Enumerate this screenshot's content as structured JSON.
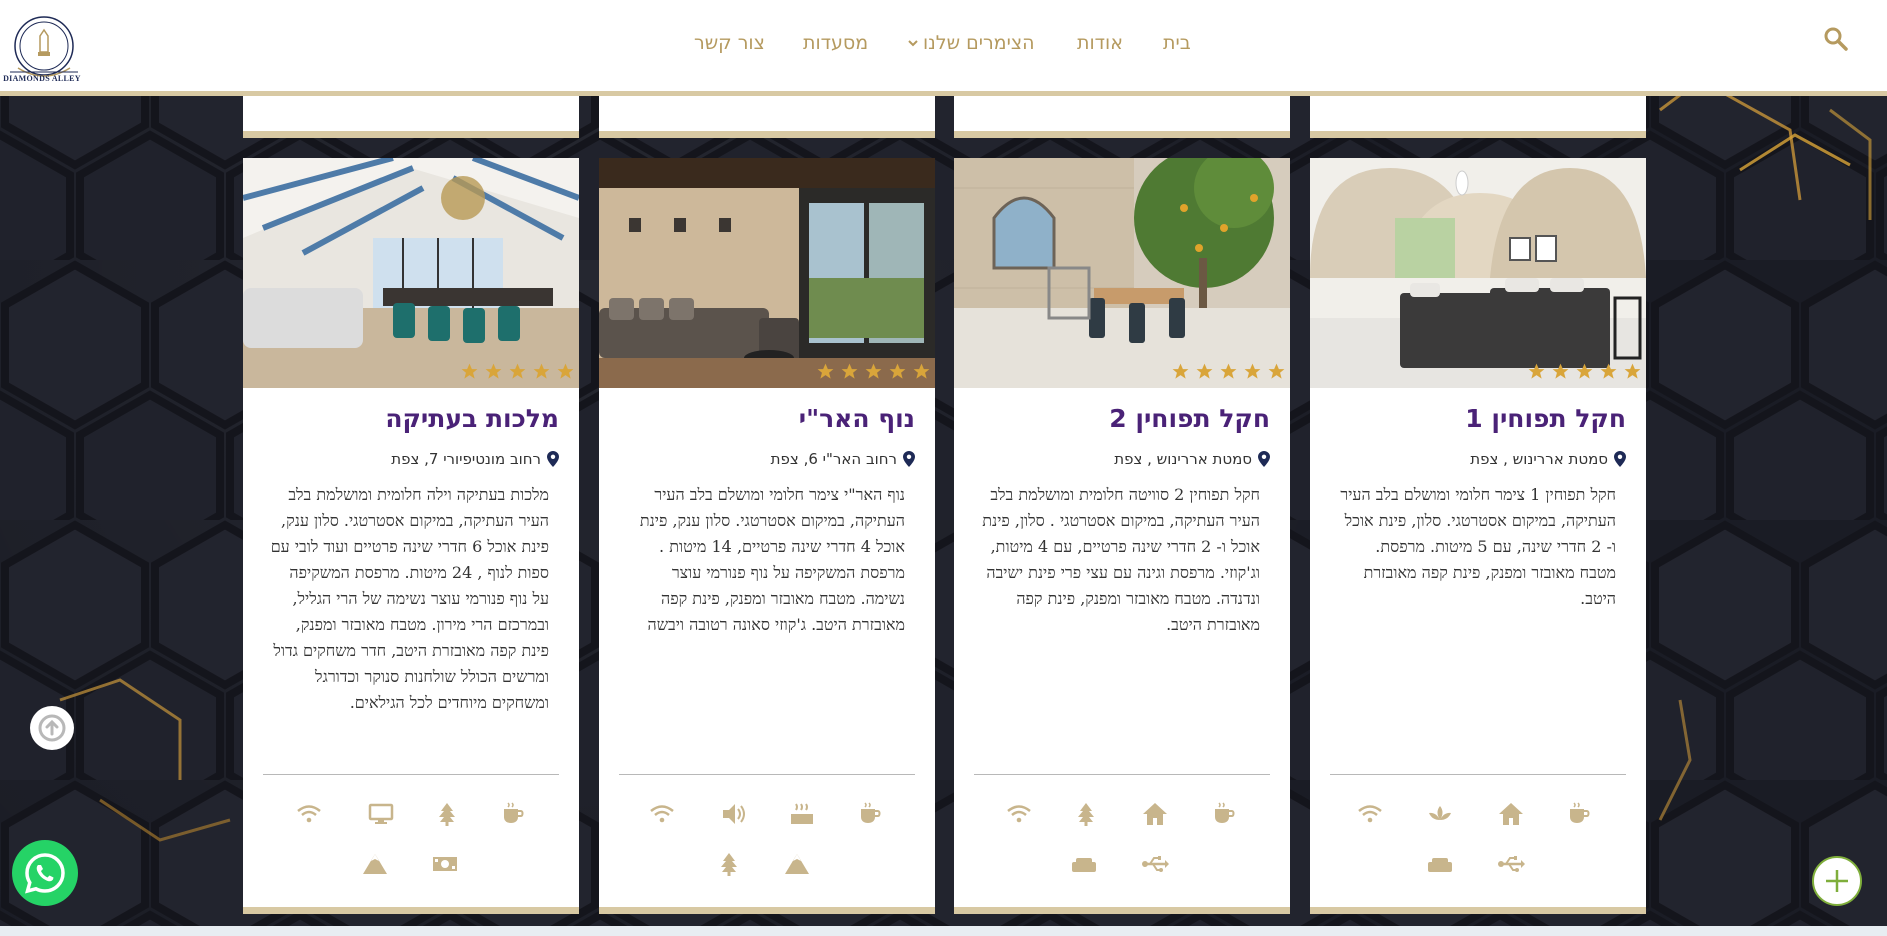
{
  "site": {
    "logo_text": "DIAMONDS ALLEY",
    "colors": {
      "accent": "#b59a5f",
      "title": "#4a2277",
      "gold_border": "#d8c9a3",
      "star": "#d9a53a"
    }
  },
  "nav": {
    "items": [
      {
        "label": "בית"
      },
      {
        "label": "אודות"
      },
      {
        "label": "הצימרים שלנו",
        "has_dropdown": true
      },
      {
        "label": "מסעדות"
      },
      {
        "label": "צור קשר"
      }
    ],
    "search_icon": "search-icon"
  },
  "cards": [
    {
      "title": "חקל תפוחין 1",
      "address": "סמטת אררינוש , צפת",
      "rating": 5,
      "description": "חקל תפוחין 1 צימר חלומי ומושלם בלב העיר העתיקה, במיקום אסטרטגי. סלון, פינת אוכל ו- 2 חדרי שינה, עם 5 מיטות. מרפסת. מטבח מאובזר ומפנק, פינת קפה מאובזרת היטב.",
      "amenities": [
        "coffee-icon",
        "home-icon",
        "spa-icon",
        "wifi-icon",
        "usb-icon",
        "sofa-icon"
      ]
    },
    {
      "title": "חקל תפוחין 2",
      "address": "סמטת אררינוש , צפת",
      "rating": 5,
      "description": "חקל תפוחין 2 סוויטה חלומית ומושלמת בלב העיר העתיקה, במיקום אסטרטגי . סלון, פינת אוכל ו- 2 חדרי שינה פרטיים, עם 4 מיטות, וג'קוזי. מרפסת וגינה עם עצי פרי פינת ישיבה ונדנדה. מטבח מאובזר ומפנק, פינת קפה מאובזרת היטב.",
      "amenities": [
        "coffee-icon",
        "home-icon",
        "tree-icon",
        "wifi-icon",
        "usb-icon",
        "sofa-icon"
      ]
    },
    {
      "title": "נוף האר\"י",
      "address": "רחוב האר\"י 6, צפת",
      "rating": 5,
      "description": "נוף האר\"י צימר חלומי ומושלם בלב העיר העתיקה, במיקום אסטרטגי. סלון ענק, פינת אוכל 4 חדרי שינה פרטיים, 14 מיטות . מרפסת המשקיפה על נוף פנורמי עוצר נשימה. מטבח מאובזר ומפנק, פינת קפה מאובזרת היטב. ג'קוזי סאונה רטובה ויבשה",
      "amenities": [
        "coffee-icon",
        "hot-tub-icon",
        "volume-icon",
        "wifi-icon",
        "mountain-icon",
        "tree-icon"
      ]
    },
    {
      "title": "מלכות בעתיקה",
      "address": "רחוב מונטיפיורי 7, צפת",
      "rating": 5,
      "description": "מלכות בעתיקה וילה חלומית ומושלמת בלב העיר העתיקה, במיקום אסטרטגי. סלון ענק, פינת אוכל 6 חדרי שינה פרטיים ועוד לובי עם ספות לנוף , 24 מיטות. מרפסת המשקיפה על נוף פנורמי עוצר נשימה של הרי הגליל, ובמרכזם הרי מירון. מטבח מאובזר ומפנק, פינת קפה מאובזרת היטב, חדר משחקים גדול ומרשים הכולל שולחנות סנוקר וכדורגל ומשחקים מיוחדים לכל הגילאים.",
      "amenities": [
        "coffee-icon",
        "tree-icon",
        "monitor-icon",
        "wifi-icon",
        "money-icon",
        "mountain-icon"
      ]
    }
  ],
  "floating": {
    "scroll_up_icon": "arrow-up-circle-icon",
    "whatsapp_icon": "whatsapp-icon",
    "plus_icon": "plus-icon"
  }
}
